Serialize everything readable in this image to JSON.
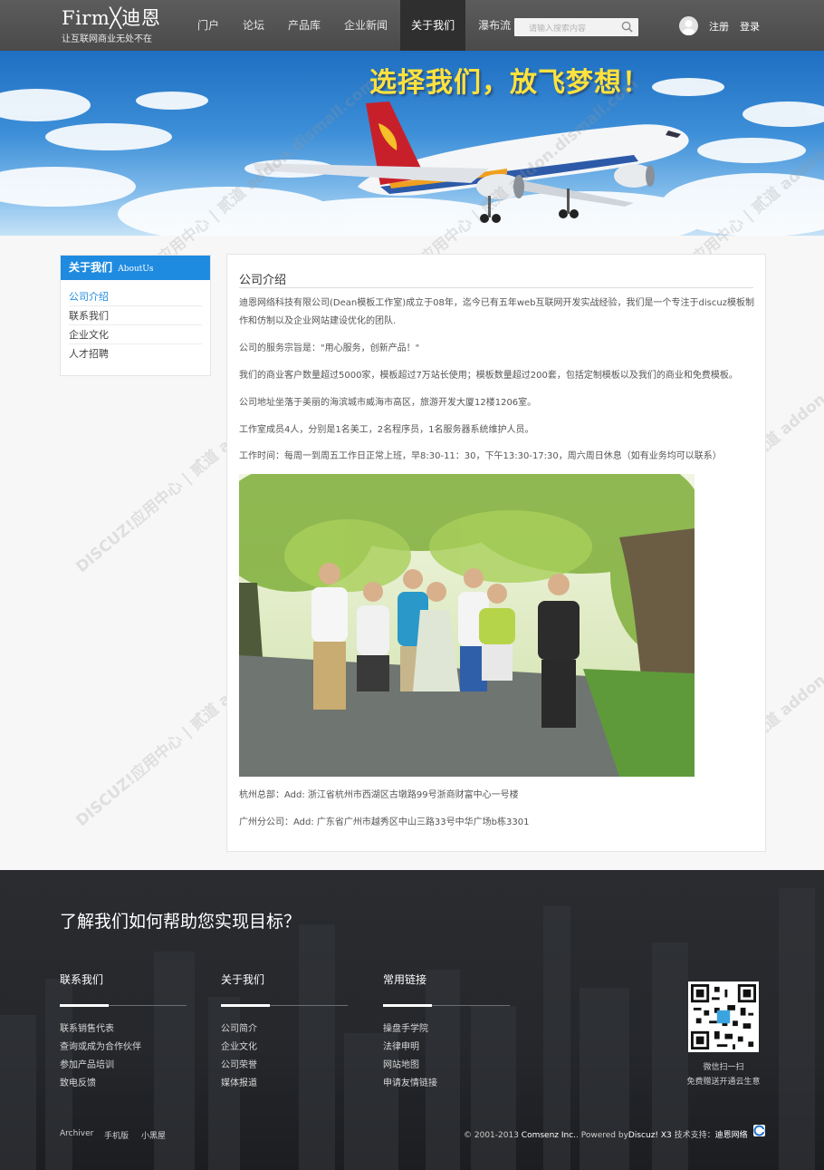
{
  "header": {
    "logo_main": "Firm╳迪恩",
    "logo_tagline": "让互联网商业无处不在",
    "nav": [
      {
        "label": "门户",
        "active": false
      },
      {
        "label": "论坛",
        "active": false
      },
      {
        "label": "产品库",
        "active": false
      },
      {
        "label": "企业新闻",
        "active": false
      },
      {
        "label": "关于我们",
        "active": true
      },
      {
        "label": "瀑布流",
        "active": false
      }
    ],
    "search_placeholder": "请输入搜索内容",
    "search_icon": "search-icon",
    "register": "注册",
    "login": "登录"
  },
  "banner": {
    "slogan": "选择我们，放飞梦想！"
  },
  "sidebar": {
    "title": "关于我们",
    "title_en": "AboutUs",
    "items": [
      {
        "label": "公司介绍",
        "active": true
      },
      {
        "label": "联系我们",
        "active": false
      },
      {
        "label": "企业文化",
        "active": false
      },
      {
        "label": "人才招聘",
        "active": false
      }
    ]
  },
  "main": {
    "title": "公司介绍",
    "paragraphs": [
      "迪恩网络科技有限公司(Dean模板工作室)成立于08年，迄今已有五年web互联网开发实战经验，我们是一个专注于discuz模板制作和仿制以及企业网站建设优化的团队.",
      "公司的服务宗旨是：\"用心服务，创新产品！\"",
      "我们的商业客户数量超过5000家，模板超过7万站长使用；模板数量超过200套，包括定制模板以及我们的商业和免费模板。",
      "公司地址坐落于美丽的海滨城市威海市高区，旅游开发大厦12楼1206室。",
      "工作室成员4人，分别是1名美工，2名程序员，1名服务器系统维护人员。",
      "工作时间：每周一到周五工作日正常上班，早8:30-11：30，下午13:30-17:30，周六周日休息（如有业务均可以联系）"
    ],
    "address_hz": "杭州总部：Add: 浙江省杭州市西湖区古墩路99号浙商财富中心一号楼",
    "address_gz": "广州分公司：Add: 广东省广州市越秀区中山三路33号中华广场b栋3301"
  },
  "footer": {
    "headline": "了解我们如何帮助您实现目标？",
    "columns": [
      {
        "title": "联系我们",
        "links": [
          "联系销售代表",
          "查询或成为合作伙伴",
          "参加产品培训",
          "致电反馈"
        ]
      },
      {
        "title": "关于我们",
        "links": [
          "公司简介",
          "企业文化",
          "公司荣誉",
          "媒体报道"
        ]
      },
      {
        "title": "常用链接",
        "links": [
          "操盘手学院",
          "法律申明",
          "网站地图",
          "申请友情链接"
        ]
      }
    ],
    "qr_caption_1": "微信扫一扫",
    "qr_caption_2": "免费赠送开通云生意",
    "bottom_links": [
      "Archiver",
      "手机版",
      "小黑屋"
    ],
    "copyright_prefix": "© 2001-2013 ",
    "copyright_company": "Comsenz Inc.",
    "powered_prefix": ".  Powered by",
    "powered_product": "Discuz! X3",
    "support_prefix": "  技术支持：",
    "support_name": "迪恩网络"
  },
  "watermark": "DISCUZ!应用中心 | 贰道 addon.dismall.com",
  "colors": {
    "accent": "#1f8be0",
    "header_bg": "#4f4f4f",
    "nav_active_bg": "#2f2f2f",
    "banner_slogan": "#ffe23d",
    "footer_bg": "#26282c"
  }
}
